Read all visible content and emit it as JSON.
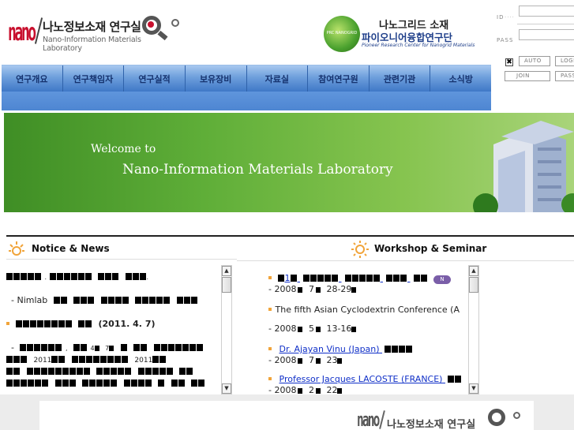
{
  "header": {
    "logo_mark": "nano",
    "logo_title_kr": "나노정보소재 연구실",
    "logo_title_en": "Nano-Information Materials Laboratory",
    "partner_title_1": "나노그리드 소재",
    "partner_title_2": "파이오니어융합연구단",
    "partner_title_3": "Pioneer Research Center for Nanogrid Materials",
    "partner_badge_text": "PRC NANOGRID"
  },
  "nav": {
    "items": [
      "연구개요",
      "연구책임자",
      "연구실적",
      "보유장비",
      "자료실",
      "참여연구원",
      "관련기관",
      "소식방"
    ]
  },
  "login": {
    "id_label": "ID",
    "pass_label": "PASS",
    "id_value": "",
    "pass_value": "",
    "auto_checked": true,
    "auto_label": "AUTO",
    "login_label": "LOGIN",
    "join_label": "JOIN",
    "pass_button_label": "PASS"
  },
  "banner": {
    "welcome": "Welcome to",
    "lab_name": "Nano-Information Materials Laboratory"
  },
  "notice": {
    "title": "Notice & News",
    "date_1": "(2011. 4. 7)",
    "line_2_prefix": "- Nimlab",
    "year_1": "2011",
    "year_2": "2011"
  },
  "workshop": {
    "title": "Workshop & Seminar",
    "items": [
      {
        "label": "1",
        "date": "- 2008",
        "date_rest": "7",
        "date_end": "28-29"
      },
      {
        "label": "The fifth Asian Cyclodextrin Conference (A",
        "date": "- 2008",
        "date_rest": "5",
        "date_end": "13-16"
      },
      {
        "label": "Dr. Ajayan Vinu (Japan)",
        "date": "- 2008",
        "date_rest": "7",
        "date_end": "23"
      },
      {
        "label": "Professor Jacques LACOSTE (FRANCE)",
        "date": "- 2008",
        "date_rest": "2",
        "date_end": "22"
      }
    ],
    "new_badge": "N"
  },
  "footer": {
    "logo_mark": "nano",
    "logo_title_kr": "나노정보소재 연구실"
  },
  "colors": {
    "nav_text": "#15326e",
    "nav_bg": "#5b8fd3",
    "banner_green": "#5fae38",
    "link_blue": "#1030c8",
    "accent_orange": "#f1a43a"
  }
}
